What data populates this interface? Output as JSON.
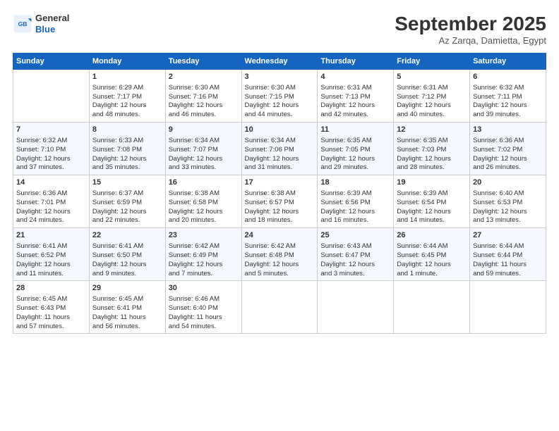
{
  "header": {
    "logo_line1": "General",
    "logo_line2": "Blue",
    "month_title": "September 2025",
    "location": "Az Zarqa, Damietta, Egypt"
  },
  "weekdays": [
    "Sunday",
    "Monday",
    "Tuesday",
    "Wednesday",
    "Thursday",
    "Friday",
    "Saturday"
  ],
  "weeks": [
    [
      {
        "day": "",
        "content": ""
      },
      {
        "day": "1",
        "content": "Sunrise: 6:29 AM\nSunset: 7:17 PM\nDaylight: 12 hours\nand 48 minutes."
      },
      {
        "day": "2",
        "content": "Sunrise: 6:30 AM\nSunset: 7:16 PM\nDaylight: 12 hours\nand 46 minutes."
      },
      {
        "day": "3",
        "content": "Sunrise: 6:30 AM\nSunset: 7:15 PM\nDaylight: 12 hours\nand 44 minutes."
      },
      {
        "day": "4",
        "content": "Sunrise: 6:31 AM\nSunset: 7:13 PM\nDaylight: 12 hours\nand 42 minutes."
      },
      {
        "day": "5",
        "content": "Sunrise: 6:31 AM\nSunset: 7:12 PM\nDaylight: 12 hours\nand 40 minutes."
      },
      {
        "day": "6",
        "content": "Sunrise: 6:32 AM\nSunset: 7:11 PM\nDaylight: 12 hours\nand 39 minutes."
      }
    ],
    [
      {
        "day": "7",
        "content": "Sunrise: 6:32 AM\nSunset: 7:10 PM\nDaylight: 12 hours\nand 37 minutes."
      },
      {
        "day": "8",
        "content": "Sunrise: 6:33 AM\nSunset: 7:08 PM\nDaylight: 12 hours\nand 35 minutes."
      },
      {
        "day": "9",
        "content": "Sunrise: 6:34 AM\nSunset: 7:07 PM\nDaylight: 12 hours\nand 33 minutes."
      },
      {
        "day": "10",
        "content": "Sunrise: 6:34 AM\nSunset: 7:06 PM\nDaylight: 12 hours\nand 31 minutes."
      },
      {
        "day": "11",
        "content": "Sunrise: 6:35 AM\nSunset: 7:05 PM\nDaylight: 12 hours\nand 29 minutes."
      },
      {
        "day": "12",
        "content": "Sunrise: 6:35 AM\nSunset: 7:03 PM\nDaylight: 12 hours\nand 28 minutes."
      },
      {
        "day": "13",
        "content": "Sunrise: 6:36 AM\nSunset: 7:02 PM\nDaylight: 12 hours\nand 26 minutes."
      }
    ],
    [
      {
        "day": "14",
        "content": "Sunrise: 6:36 AM\nSunset: 7:01 PM\nDaylight: 12 hours\nand 24 minutes."
      },
      {
        "day": "15",
        "content": "Sunrise: 6:37 AM\nSunset: 6:59 PM\nDaylight: 12 hours\nand 22 minutes."
      },
      {
        "day": "16",
        "content": "Sunrise: 6:38 AM\nSunset: 6:58 PM\nDaylight: 12 hours\nand 20 minutes."
      },
      {
        "day": "17",
        "content": "Sunrise: 6:38 AM\nSunset: 6:57 PM\nDaylight: 12 hours\nand 18 minutes."
      },
      {
        "day": "18",
        "content": "Sunrise: 6:39 AM\nSunset: 6:56 PM\nDaylight: 12 hours\nand 16 minutes."
      },
      {
        "day": "19",
        "content": "Sunrise: 6:39 AM\nSunset: 6:54 PM\nDaylight: 12 hours\nand 14 minutes."
      },
      {
        "day": "20",
        "content": "Sunrise: 6:40 AM\nSunset: 6:53 PM\nDaylight: 12 hours\nand 13 minutes."
      }
    ],
    [
      {
        "day": "21",
        "content": "Sunrise: 6:41 AM\nSunset: 6:52 PM\nDaylight: 12 hours\nand 11 minutes."
      },
      {
        "day": "22",
        "content": "Sunrise: 6:41 AM\nSunset: 6:50 PM\nDaylight: 12 hours\nand 9 minutes."
      },
      {
        "day": "23",
        "content": "Sunrise: 6:42 AM\nSunset: 6:49 PM\nDaylight: 12 hours\nand 7 minutes."
      },
      {
        "day": "24",
        "content": "Sunrise: 6:42 AM\nSunset: 6:48 PM\nDaylight: 12 hours\nand 5 minutes."
      },
      {
        "day": "25",
        "content": "Sunrise: 6:43 AM\nSunset: 6:47 PM\nDaylight: 12 hours\nand 3 minutes."
      },
      {
        "day": "26",
        "content": "Sunrise: 6:44 AM\nSunset: 6:45 PM\nDaylight: 12 hours\nand 1 minute."
      },
      {
        "day": "27",
        "content": "Sunrise: 6:44 AM\nSunset: 6:44 PM\nDaylight: 11 hours\nand 59 minutes."
      }
    ],
    [
      {
        "day": "28",
        "content": "Sunrise: 6:45 AM\nSunset: 6:43 PM\nDaylight: 11 hours\nand 57 minutes."
      },
      {
        "day": "29",
        "content": "Sunrise: 6:45 AM\nSunset: 6:41 PM\nDaylight: 11 hours\nand 56 minutes."
      },
      {
        "day": "30",
        "content": "Sunrise: 6:46 AM\nSunset: 6:40 PM\nDaylight: 11 hours\nand 54 minutes."
      },
      {
        "day": "",
        "content": ""
      },
      {
        "day": "",
        "content": ""
      },
      {
        "day": "",
        "content": ""
      },
      {
        "day": "",
        "content": ""
      }
    ]
  ]
}
